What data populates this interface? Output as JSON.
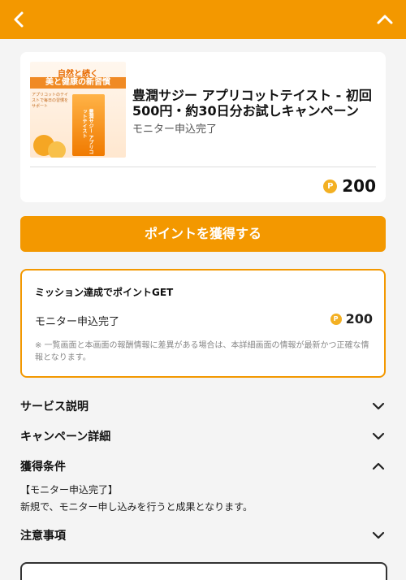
{
  "header": {
    "back_icon": "chevron-left-icon",
    "collapse_icon": "chevron-up-icon",
    "color": "#f39800"
  },
  "offer": {
    "thumb": {
      "line1": "自然と続く",
      "line2": "美と健康の新習慣",
      "body": "アプリコットのテイストで毎日の習慣をサポート",
      "carton_text": "豊潤サジー アプリコットテイスト"
    },
    "title": "豊潤サジー アプリコットテイスト - 初回500円・約30日分お試しキャンペーン",
    "status": "モニター申込完了",
    "points": "200",
    "point_icon": "P"
  },
  "cta": {
    "label": "ポイントを獲得する"
  },
  "mission": {
    "title": "ミッション達成でポイントGET",
    "label": "モニター申込完了",
    "points": "200",
    "note": "※ 一覧画面と本画面の報酬情報に差異がある場合は、本詳細画面の情報が最新かつ正確な情報となります。"
  },
  "sections": {
    "service": "サービス説明",
    "campaign": "キャンペーン詳細",
    "conditions": "獲得条件",
    "notes": "注意事項"
  },
  "conditions": {
    "title": "【モニター申込完了】",
    "text": "新規で、モニター申し込みを行うと成果となります。"
  }
}
